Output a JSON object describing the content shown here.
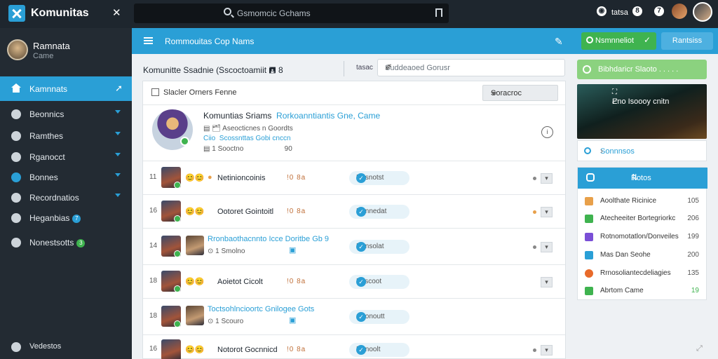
{
  "app": {
    "name": "Komunitas",
    "search_placeholder": "Gsmomcic Gchams",
    "top_right_label": "tatsa",
    "top_icon_1": "8",
    "top_icon_2": "7"
  },
  "sidebar": {
    "profile_name": "Ramnata",
    "profile_sub": "Came",
    "active_item": "Kamnnats",
    "items": [
      {
        "label": "Beonnics",
        "icon": "gear-icon"
      },
      {
        "label": "Ramthes",
        "icon": "home-icon"
      },
      {
        "label": "Rganocct",
        "icon": "user-icon"
      },
      {
        "label": "Bonnes",
        "icon": "globe-icon"
      },
      {
        "label": "Recordnatios",
        "icon": "gear-icon"
      },
      {
        "label": "Heganbias",
        "badge": "7",
        "icon": "globe-icon"
      },
      {
        "label": "Nonestsotts",
        "badge": "3",
        "icon": "chat-icon"
      }
    ],
    "bottom_label": "Vedestos"
  },
  "header": {
    "title": "Rommouitas Cop Nams",
    "green_button": "Nsmnneliot",
    "blue_button": "Rantsiss"
  },
  "subheader": {
    "title": "Komunitte Ssadnie (Sscoctoamiit 🖪 8",
    "btn": "tasac",
    "search_placeholder": "Suddeaoed Gorusr"
  },
  "card": {
    "head_label": "Slacler Orners Fenne",
    "select_value": "Soracroc",
    "feature": {
      "title": "Komuntias Sriams",
      "title_highlight": "Rorkoanntiantis Gne, Came",
      "line2": "Aseocticnes n Goordts",
      "line3_a": "Ciio",
      "line3_b": "Scossnttas  Gobi cnccn",
      "line4": "1 Sooctno",
      "line4_icon": "90"
    },
    "rows": [
      {
        "num": "11",
        "name": "Netinioncoinis",
        "tags": "!0 8a",
        "pill": "Nosnotst"
      },
      {
        "num": "16",
        "name": "Ootoret Gointoitl",
        "tags": "!0 8a",
        "pill": "Nonnedat"
      },
      {
        "num": "14",
        "name": "Rronbaothacnnto Icce Doritbe Gb 9",
        "sub": "1 Smolno",
        "pill": "Nonsolat"
      },
      {
        "num": "18",
        "name": "Aoietot Cicolt",
        "tags": "!0 8a",
        "pill": "Boscoot"
      },
      {
        "num": "18",
        "name": "Toctsohlncioortc Gnilogee Gots",
        "sub": "1 Scouro",
        "pill": "Oconoutt"
      },
      {
        "num": "16",
        "name": "Notorot Gocnnicd",
        "tags": "!0 8a",
        "pill": "Nonoolt"
      }
    ]
  },
  "right": {
    "green_bar": "Bibhdaricr Slaoto . . . . .",
    "video_title": "Eno Isoooy cnitn",
    "search_row": "Sonnnsos",
    "panel_title": "Rotos",
    "items": [
      {
        "label": "Aoolthate Ricinice",
        "value": "105",
        "color": "#e8a04a"
      },
      {
        "label": "Atecheeiter Bortegriorkc",
        "value": "206",
        "color": "#3fb34f"
      },
      {
        "label": "Rotnomotatlon/Donveiles",
        "value": "199",
        "color": "#7a4fd6"
      },
      {
        "label": "Mas Dan Seohe",
        "value": "200",
        "color": "#2a9fd6"
      },
      {
        "label": "Rrnosoliantecdeliagies",
        "value": "135",
        "color": "#e86a2a"
      },
      {
        "label": "Abrtom Came",
        "value": "19",
        "color": "#3fb34f"
      }
    ]
  }
}
